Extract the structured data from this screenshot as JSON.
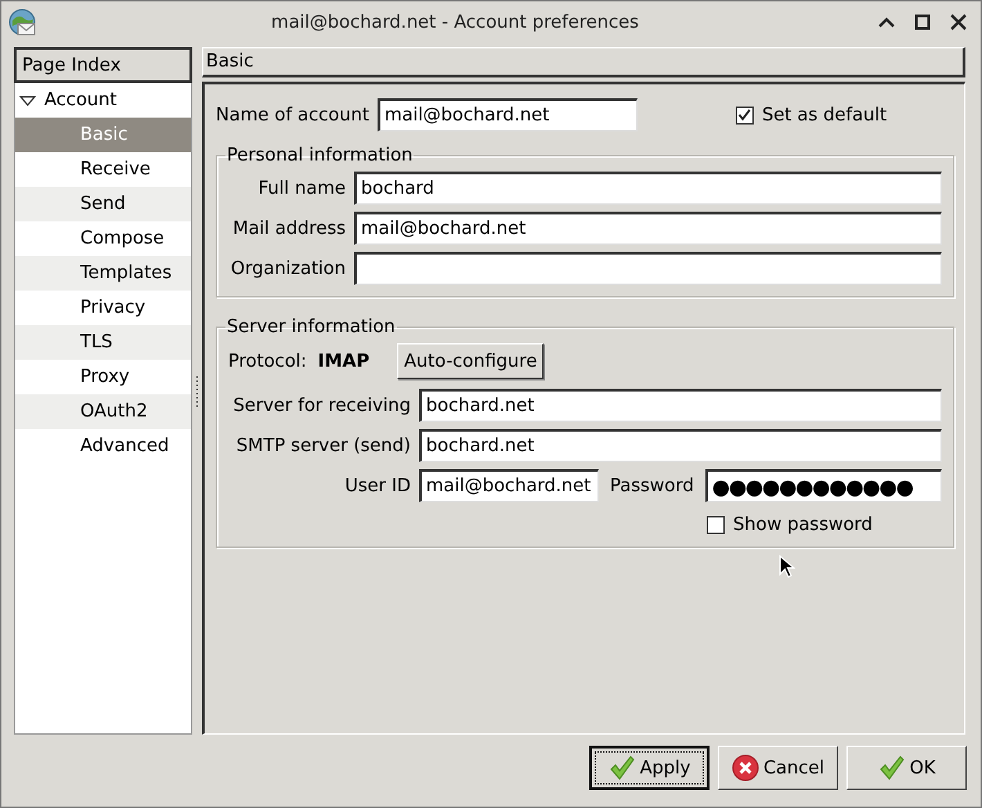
{
  "window": {
    "title": "mail@bochard.net - Account preferences"
  },
  "sidebar": {
    "header": "Page Index",
    "items": [
      {
        "label": "Account",
        "expanded": true,
        "selected": false,
        "children": [
          {
            "label": "Basic",
            "selected": true
          },
          {
            "label": "Receive",
            "selected": false
          },
          {
            "label": "Send",
            "selected": false
          },
          {
            "label": "Compose",
            "selected": false
          },
          {
            "label": "Templates",
            "selected": false
          },
          {
            "label": "Privacy",
            "selected": false
          },
          {
            "label": "TLS",
            "selected": false
          },
          {
            "label": "Proxy",
            "selected": false
          },
          {
            "label": "OAuth2",
            "selected": false
          },
          {
            "label": "Advanced",
            "selected": false
          }
        ]
      }
    ]
  },
  "page": {
    "header": "Basic",
    "account_name": {
      "label": "Name of account",
      "value": "mail@bochard.net"
    },
    "set_as_default": {
      "label": "Set as default",
      "checked": true
    },
    "personal": {
      "title": "Personal information",
      "fields": [
        {
          "label": "Full name",
          "value": "bochard"
        },
        {
          "label": "Mail address",
          "value": "mail@bochard.net"
        },
        {
          "label": "Organization"
        }
      ]
    },
    "server": {
      "title": "Server information",
      "protocol_label": "Protocol:",
      "protocol": "IMAP",
      "auto_configure": "Auto-configure",
      "fields": [
        {
          "label": "Server for receiving",
          "value": "bochard.net"
        },
        {
          "label": "SMTP server (send)",
          "value": "bochard.net"
        }
      ],
      "user_id": {
        "label": "User ID",
        "value": "mail@bochard.net"
      },
      "password": {
        "label": "Password",
        "value": "●●●●●●●●●●●●"
      },
      "show_password": {
        "label": "Show password",
        "checked": false
      }
    }
  },
  "buttons": [
    {
      "label": "Apply",
      "kind": "apply",
      "focused": true
    },
    {
      "label": "Cancel",
      "kind": "cancel",
      "focused": false
    },
    {
      "label": "OK",
      "kind": "ok",
      "focused": false
    }
  ]
}
